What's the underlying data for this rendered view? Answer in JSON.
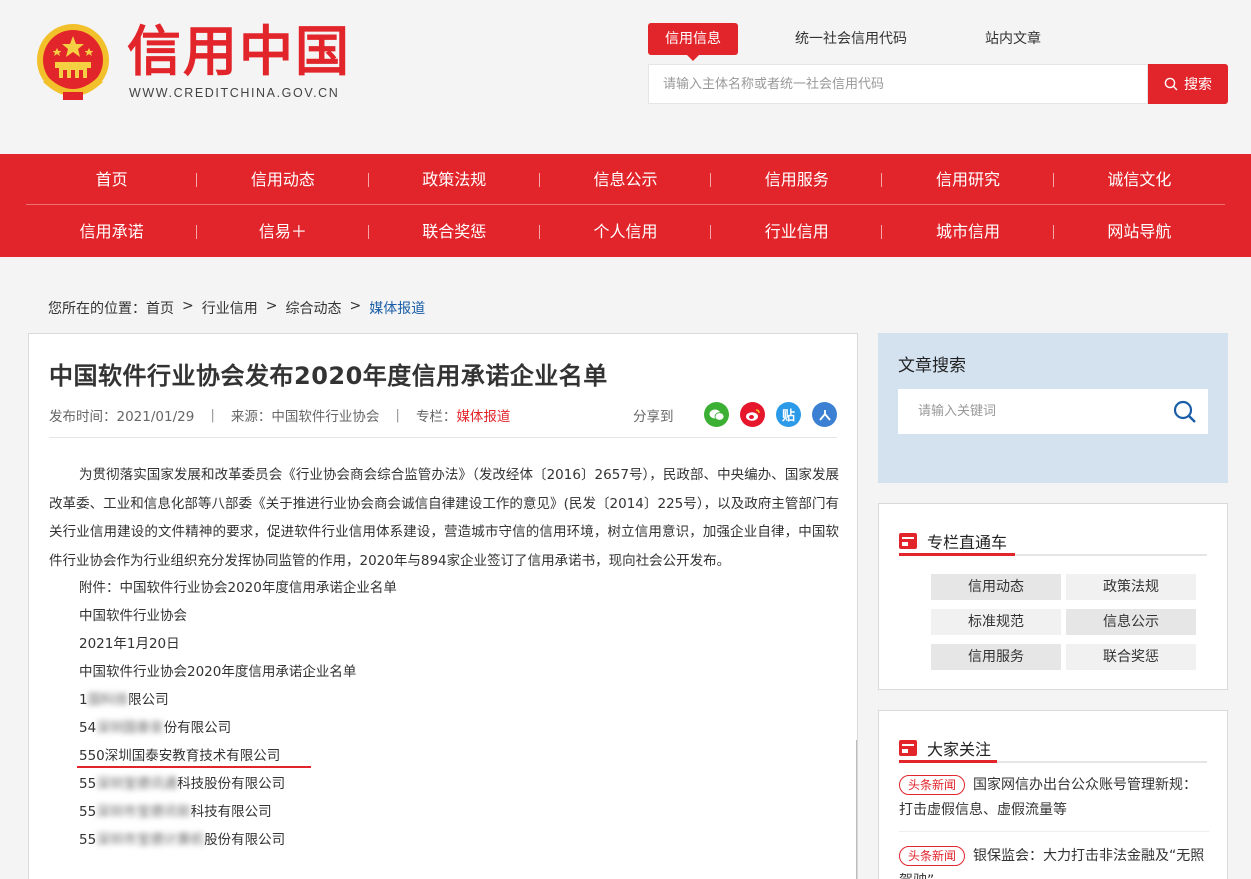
{
  "header": {
    "logo_text": "信用中国",
    "logo_url": "WWW.CREDITCHINA.GOV.CN",
    "search_tabs": [
      "信用信息",
      "统一社会信用代码",
      "站内文章"
    ],
    "search_placeholder": "请输入主体名称或者统一社会信用代码",
    "search_button": "搜索"
  },
  "nav": {
    "row1": [
      "首页",
      "信用动态",
      "政策法规",
      "信息公示",
      "信用服务",
      "信用研究",
      "诚信文化"
    ],
    "row2": [
      "信用承诺",
      "信易＋",
      "联合奖惩",
      "个人信用",
      "行业信用",
      "城市信用",
      "网站导航"
    ]
  },
  "breadcrumb": {
    "prefix": "您所在的位置：",
    "items": [
      "首页",
      "行业信用",
      "综合动态"
    ],
    "separator": ">",
    "current": "媒体报道"
  },
  "article": {
    "title": "中国软件行业协会发布2020年度信用承诺企业名单",
    "publish_time": "发布时间：2021/01/29",
    "source": "来源：中国软件行业协会",
    "column_label": "专栏：",
    "column_value": "媒体报道",
    "share_label": "分享到",
    "share_icons": [
      "wechat-icon",
      "weibo-icon",
      "tieba-icon",
      "renren-icon"
    ],
    "paragraph": "为贯彻落实国家发展和改革委员会《行业协会商会综合监管办法》（发改经体〔2016〕2657号），民政部、中央编办、国家发展改革委、工业和信息化部等八部委《关于推进行业协会商会诚信自律建设工作的意见》(民发〔2014〕225号），以及政府主管部门有关行业信用建设的文件精神的要求，促进软件行业信用体系建设，营造城市守信的信用环境，树立信用意识，加强企业自律，中国软件行业协会作为行业组织充分发挥协同监管的作用，2020年与894家企业签订了信用承诺书，现向社会公开发布。",
    "lines": [
      "附件：中国软件行业协会2020年度信用承诺企业名单",
      "中国软件行业协会",
      "2021年1月20日",
      "中国软件行业协会2020年度信用承诺企业名单"
    ],
    "list_items": [
      {
        "visible": "1",
        "blurred": "国科技",
        "tail": "限公司"
      },
      {
        "visible": "54",
        "blurred": "深圳国泰安",
        "tail": "份有限公司"
      },
      {
        "visible": "550深圳国泰安教育技术有限公司",
        "blurred": "",
        "tail": ""
      },
      {
        "visible": "55",
        "blurred": "深圳宝德讯通",
        "tail": "科技股份有限公司"
      },
      {
        "visible": "55",
        "blurred": "深圳市宝德讯软",
        "tail": "科技有限公司"
      },
      {
        "visible": "55",
        "blurred": "深圳市宝德计算机",
        "tail": "股份有限公司"
      }
    ]
  },
  "sidebar": {
    "search_title": "文章搜索",
    "search_placeholder": "请输入关键词",
    "column_box_title": "专栏直通车",
    "columns": [
      "信用动态",
      "政策法规",
      "标准规范",
      "信息公示",
      "信用服务",
      "联合奖惩"
    ],
    "focus_title": "大家关注",
    "news": [
      {
        "tag": "头条新闻",
        "text": "国家网信办出台公众账号管理新规：打击虚假信息、虚假流量等"
      },
      {
        "tag": "头条新闻",
        "text": "银保监会：大力打击非法金融及“无照驾驶”"
      }
    ]
  },
  "colors": {
    "brand_red": "#e2252b",
    "link_blue": "#1a5ea8",
    "side_search_bg": "#d4e2f0"
  }
}
